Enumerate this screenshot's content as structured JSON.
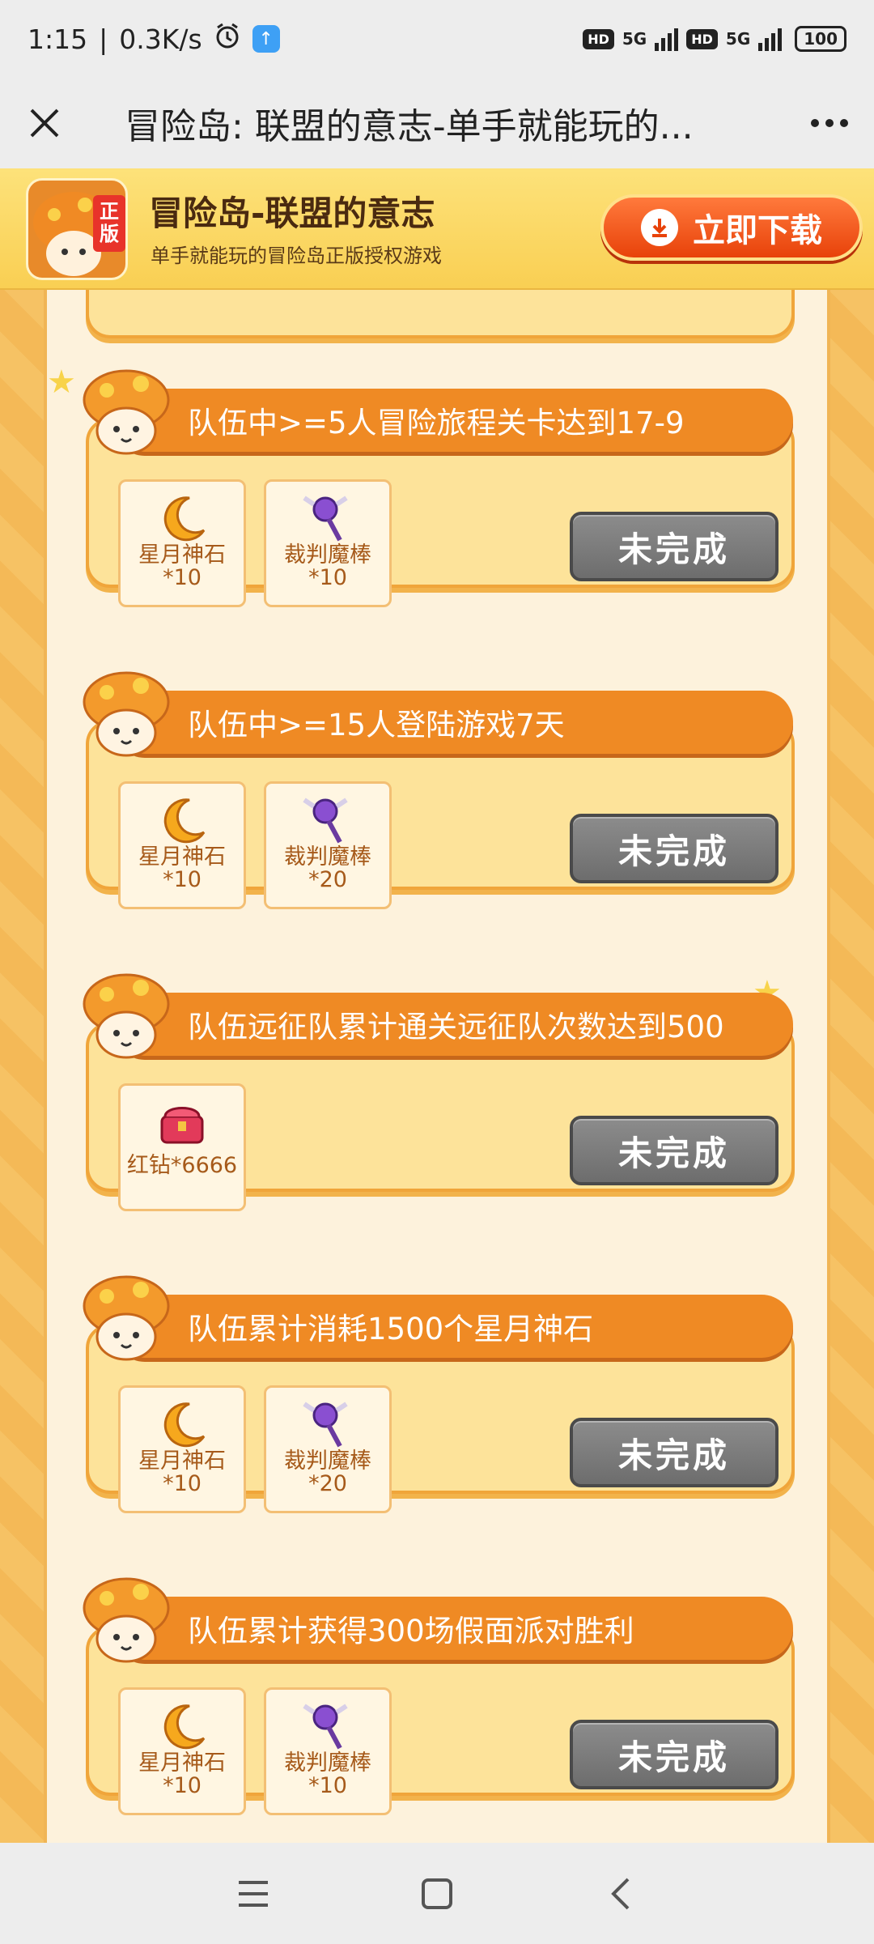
{
  "status_bar": {
    "time": "1:15",
    "net_speed": "0.3K/s",
    "network1": "5G",
    "network2": "5G",
    "hd": "HD",
    "battery": "100"
  },
  "header": {
    "title": "冒险岛: 联盟的意志-单手就能玩的..."
  },
  "banner": {
    "app_name": "冒险岛-联盟的意志",
    "subtitle": "单手就能玩的冒险岛正版授权游戏",
    "logo_text": "正版",
    "download_label": "立即下载"
  },
  "tasks": [
    {
      "title": "队伍中>=5人冒险旅程关卡达到17-9",
      "rewards": [
        {
          "name": "星月神石",
          "qty": "*10",
          "icon": "moon-stone-icon"
        },
        {
          "name": "裁判魔棒",
          "qty": "*10",
          "icon": "judge-wand-icon"
        }
      ],
      "status": "未完成"
    },
    {
      "title": "队伍中>=15人登陆游戏7天",
      "rewards": [
        {
          "name": "星月神石",
          "qty": "*10",
          "icon": "moon-stone-icon"
        },
        {
          "name": "裁判魔棒",
          "qty": "*20",
          "icon": "judge-wand-icon"
        }
      ],
      "status": "未完成"
    },
    {
      "title": "队伍远征队累计通关远征队次数达到500",
      "rewards": [
        {
          "name": "红钻*6666",
          "qty": "",
          "icon": "red-diamond-chest-icon"
        }
      ],
      "status": "未完成"
    },
    {
      "title": "队伍累计消耗1500个星月神石",
      "rewards": [
        {
          "name": "星月神石",
          "qty": "*10",
          "icon": "moon-stone-icon"
        },
        {
          "name": "裁判魔棒",
          "qty": "*20",
          "icon": "judge-wand-icon"
        }
      ],
      "status": "未完成"
    },
    {
      "title": "队伍累计获得300场假面派对胜利",
      "rewards": [
        {
          "name": "星月神石",
          "qty": "*10",
          "icon": "moon-stone-icon"
        },
        {
          "name": "裁判魔棒",
          "qty": "*10",
          "icon": "judge-wand-icon"
        }
      ],
      "status": "未完成"
    }
  ]
}
